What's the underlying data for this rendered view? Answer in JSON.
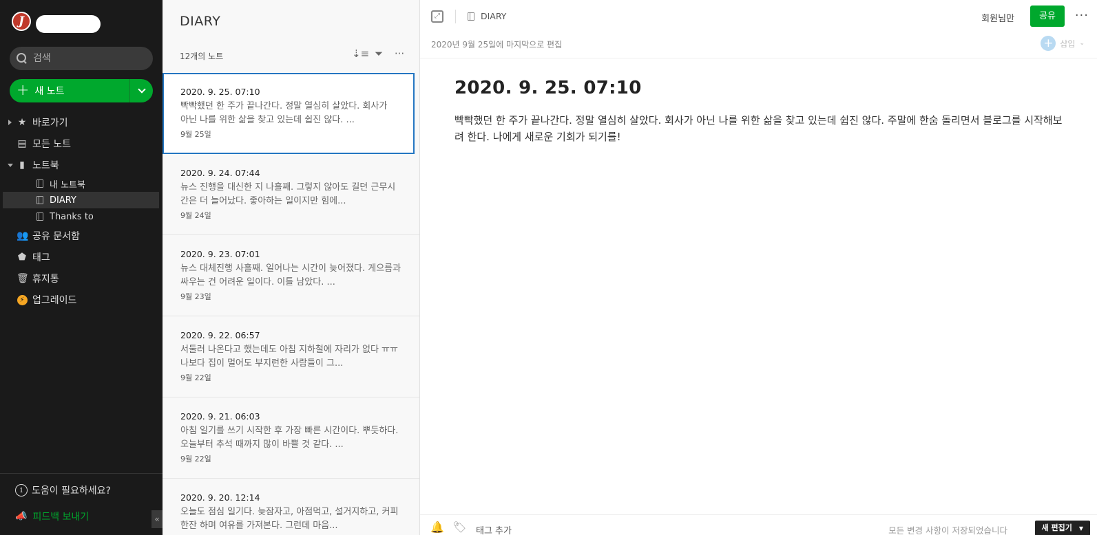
{
  "sidebar": {
    "avatar_letter": "J",
    "search_placeholder": "검색",
    "new_note_label": "새 노트",
    "items": [
      {
        "label": "바로가기"
      },
      {
        "label": "모든 노트"
      },
      {
        "label": "노트북"
      },
      {
        "label": "공유 문서함"
      },
      {
        "label": "태그"
      },
      {
        "label": "휴지통"
      },
      {
        "label": "업그레이드"
      }
    ],
    "notebooks": [
      {
        "label": "내 노트북"
      },
      {
        "label": "DIARY"
      },
      {
        "label": "Thanks to"
      }
    ],
    "help_label": "도움이 필요하세요?",
    "feedback_label": "피드백 보내기",
    "collapse_glyph": "«"
  },
  "notelist": {
    "title": "DIARY",
    "count": "12개의 노트",
    "notes": [
      {
        "title": "2020. 9. 25. 07:10",
        "snippet": "빡빡했던 한 주가 끝나간다. 정말 열심히 살았다. 회사가 아닌 나를 위한 삶을 찾고 있는데 쉽진 않다. ...",
        "date": "9월 25일"
      },
      {
        "title": "2020. 9. 24. 07:44",
        "snippet": "뉴스 진행을 대신한 지 나흘째. 그렇지 않아도 길던 근무시간은 더 늘어났다. 좋아하는 일이지만 힘에...",
        "date": "9월 24일"
      },
      {
        "title": "2020. 9. 23. 07:01",
        "snippet": "뉴스 대체진행 사흘째. 일어나는 시간이 늦어졌다. 게으름과 싸우는 건 어려운 일이다. 이틀 남았다. ...",
        "date": "9월 23일"
      },
      {
        "title": "2020. 9. 22. 06:57",
        "snippet": "서둘러 나온다고 했는데도 아침 지하철에 자리가 없다 ㅠㅠ 나보다 집이 멀어도 부지런한 사람들이 그...",
        "date": "9월 22일"
      },
      {
        "title": "2020. 9. 21. 06:03",
        "snippet": "아침 일기를 쓰기 시작한 후 가장 빠른 시간이다. 뿌듯하다. 오늘부터 추석 때까지 많이 바쁠 것 같다. ...",
        "date": "9월 22일"
      },
      {
        "title": "2020. 9. 20. 12:14",
        "snippet": "오늘도 점심 일기다. 늦잠자고, 아점먹고, 설거지하고, 커피 한잔 하며 여유를 가져본다. 그런데 마음...",
        "date": ""
      }
    ]
  },
  "editor": {
    "breadcrumb": "DIARY",
    "members_label": "회원님만",
    "share_label": "공유",
    "more_glyph": "···",
    "last_edited": "2020년 9월 25일에 마지막으로 편집",
    "insert_label": "삽입",
    "note_title": "2020. 9. 25. 07:10",
    "note_body": "빡빡했던 한 주가 끝나간다. 정말 열심히 살았다. 회사가 아닌 나를 위한 삶을 찾고 있는데 쉽진 않다. 주말에 한숨 돌리면서 블로그를 시작해보려 한다. 나에게 새로운 기회가 되기를!",
    "add_tag_label": "태그 추가",
    "saved_status": "모든 변경 사항이 저장되었습니다",
    "new_editor_label": "새 편집기"
  },
  "colors": {
    "accent_green": "#00a82d",
    "selection_blue": "#2476c2",
    "sidebar_bg": "#1a1a1a"
  }
}
